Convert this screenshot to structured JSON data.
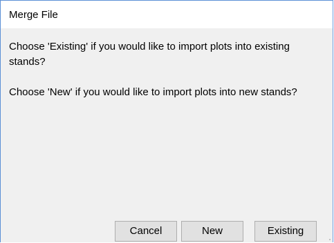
{
  "dialog": {
    "title": "Merge File",
    "message_existing": "Choose 'Existing' if you would like to import plots into existing stands?",
    "message_new": "Choose 'New' if you would like to import plots into new stands?"
  },
  "buttons": {
    "cancel_label": "Cancel",
    "new_label": "New",
    "existing_label": "Existing"
  },
  "colors": {
    "window_border": "#5b8fd6",
    "dialog_background": "#f0f0f0",
    "button_background": "#e1e1e1"
  }
}
